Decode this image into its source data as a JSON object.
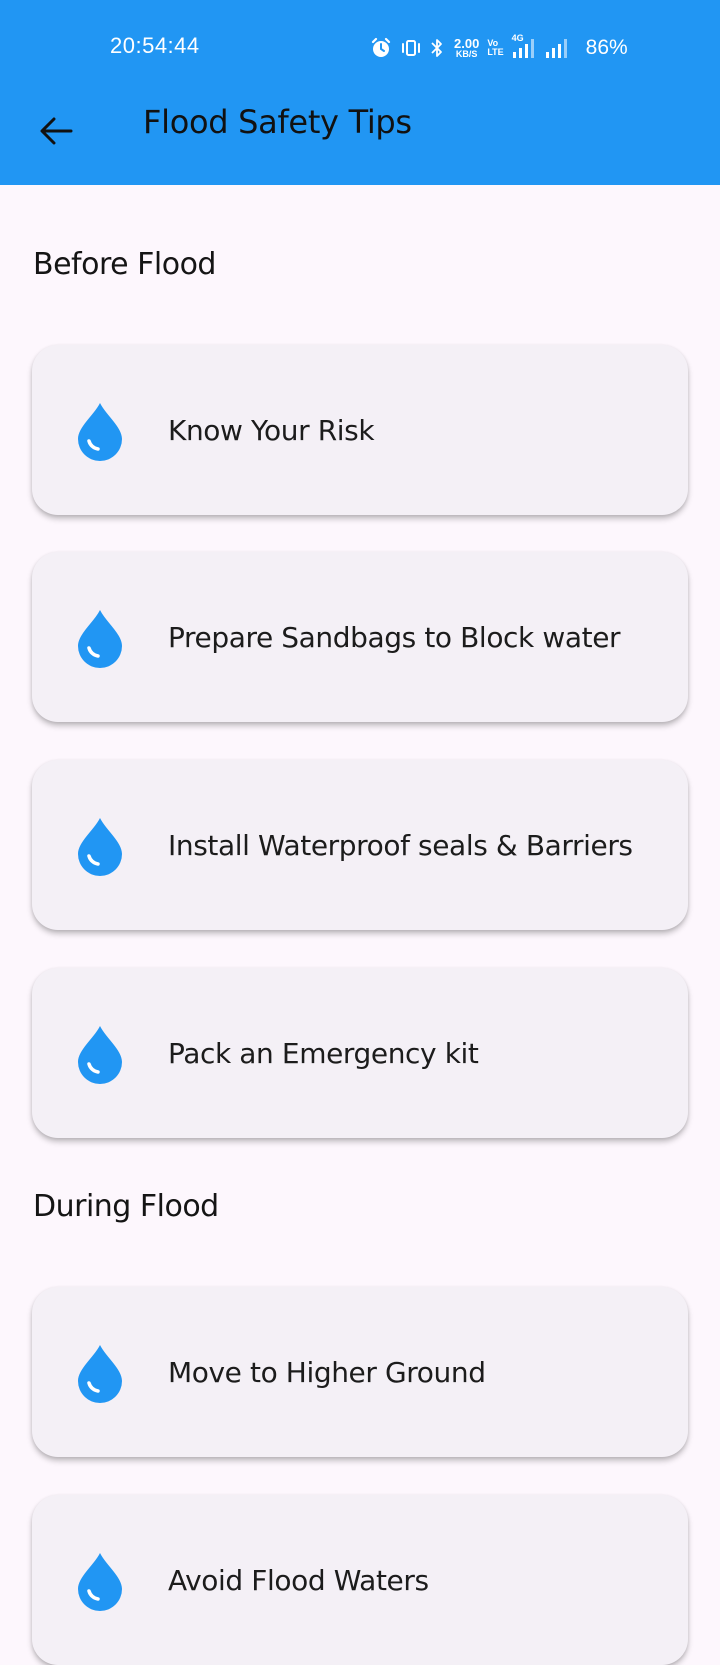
{
  "status_bar": {
    "time": "20:54:44",
    "net_speed_value": "2.00",
    "net_speed_unit": "KB/S",
    "volte_top": "Vo",
    "volte_bottom": "LTE",
    "network_type": "4G",
    "battery": "86%"
  },
  "app_bar": {
    "title": "Flood Safety Tips",
    "color": "#2196f3"
  },
  "sections": [
    {
      "heading": "Before Flood",
      "tips": [
        {
          "label": "Know Your Risk",
          "icon": "water-drop-icon"
        },
        {
          "label": "Prepare Sandbags to Block water",
          "icon": "water-drop-icon"
        },
        {
          "label": "Install Waterproof seals & Barriers",
          "icon": "water-drop-icon"
        },
        {
          "label": "Pack an Emergency kit",
          "icon": "water-drop-icon"
        }
      ]
    },
    {
      "heading": "During Flood",
      "tips": [
        {
          "label": "Move to Higher Ground",
          "icon": "water-drop-icon"
        },
        {
          "label": "Avoid Flood Waters",
          "icon": "water-drop-icon"
        }
      ]
    }
  ]
}
